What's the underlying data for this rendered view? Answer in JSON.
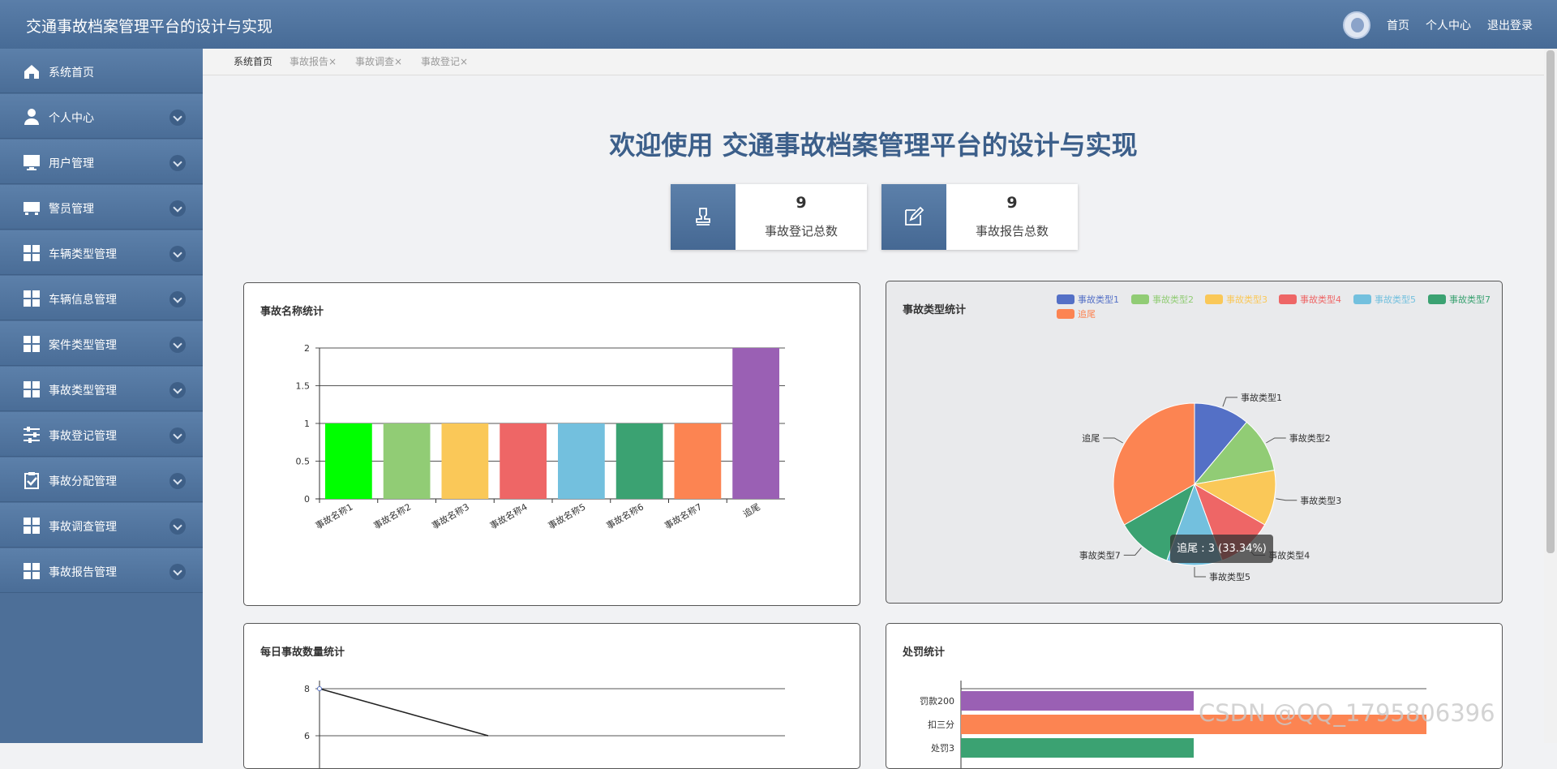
{
  "app": {
    "title": "交通事故档案管理平台的设计与实现"
  },
  "topnav": {
    "home": "首页",
    "profile": "个人中心",
    "logout": "退出登录"
  },
  "sidebar": {
    "items": [
      {
        "label": "系统首页",
        "icon": "home-icon"
      },
      {
        "label": "个人中心",
        "icon": "user-icon"
      },
      {
        "label": "用户管理",
        "icon": "monitor-icon"
      },
      {
        "label": "警员管理",
        "icon": "tray-icon"
      },
      {
        "label": "车辆类型管理",
        "icon": "grid-icon"
      },
      {
        "label": "车辆信息管理",
        "icon": "grid-icon"
      },
      {
        "label": "案件类型管理",
        "icon": "grid-icon"
      },
      {
        "label": "事故类型管理",
        "icon": "grid-icon"
      },
      {
        "label": "事故登记管理",
        "icon": "sliders-icon"
      },
      {
        "label": "事故分配管理",
        "icon": "clipboard-check-icon"
      },
      {
        "label": "事故调查管理",
        "icon": "grid-icon"
      },
      {
        "label": "事故报告管理",
        "icon": "grid-icon"
      }
    ]
  },
  "tabs": [
    {
      "label": "系统首页"
    },
    {
      "label": "事故报告×"
    },
    {
      "label": "事故调查×"
    },
    {
      "label": "事故登记×"
    }
  ],
  "welcome": "欢迎使用 交通事故档案管理平台的设计与实现",
  "stats": [
    {
      "value": "9",
      "label": "事故登记总数",
      "icon": "stamp-icon"
    },
    {
      "value": "9",
      "label": "事故报告总数",
      "icon": "edit-icon"
    }
  ],
  "panels": {
    "accident_name": {
      "title": "事故名称统计"
    },
    "accident_type": {
      "title": "事故类型统计"
    },
    "daily": {
      "title": "每日事故数量统计"
    },
    "penalty": {
      "title": "处罚统计"
    }
  },
  "tooltip": "追尾 : 3 (33.34%)",
  "watermark": "CSDN @QQ_1795806396",
  "chart_data": [
    {
      "type": "bar",
      "title": "事故名称统计",
      "categories": [
        "事故名称1",
        "事故名称2",
        "事故名称3",
        "事故名称4",
        "事故名称5",
        "事故名称6",
        "事故名称7",
        "追尾"
      ],
      "values": [
        1,
        1,
        1,
        1,
        1,
        1,
        1,
        2
      ],
      "colors": [
        "#00ff00",
        "#91cc75",
        "#fac858",
        "#ee6666",
        "#73c0de",
        "#3ba272",
        "#fc8452",
        "#9a60b4"
      ],
      "ylim": [
        0,
        2
      ],
      "yticks": [
        "0",
        "0.5",
        "1",
        "1.5",
        "2"
      ]
    },
    {
      "type": "pie",
      "title": "事故类型统计",
      "legend": "top-right",
      "slices": [
        {
          "name": "事故类型1",
          "value": 1,
          "color": "#5470c6"
        },
        {
          "name": "事故类型2",
          "value": 1,
          "color": "#91cc75"
        },
        {
          "name": "事故类型3",
          "value": 1,
          "color": "#fac858"
        },
        {
          "name": "事故类型4",
          "value": 1,
          "color": "#ee6666"
        },
        {
          "name": "事故类型5",
          "value": 1,
          "color": "#73c0de"
        },
        {
          "name": "事故类型7",
          "value": 1,
          "color": "#3ba272"
        },
        {
          "name": "追尾",
          "value": 3,
          "color": "#fc8452"
        }
      ]
    },
    {
      "type": "line",
      "title": "每日事故数量统计",
      "yticks": [
        "8",
        "6"
      ],
      "values": [
        8,
        7.5,
        7,
        6.5,
        6
      ]
    },
    {
      "type": "bar",
      "orientation": "horizontal",
      "title": "处罚统计",
      "categories": [
        "罚款200",
        "扣三分",
        "处罚3"
      ],
      "values": [
        1,
        2,
        1
      ],
      "colors": [
        "#9a60b4",
        "#fc8452",
        "#3ba272"
      ]
    }
  ]
}
